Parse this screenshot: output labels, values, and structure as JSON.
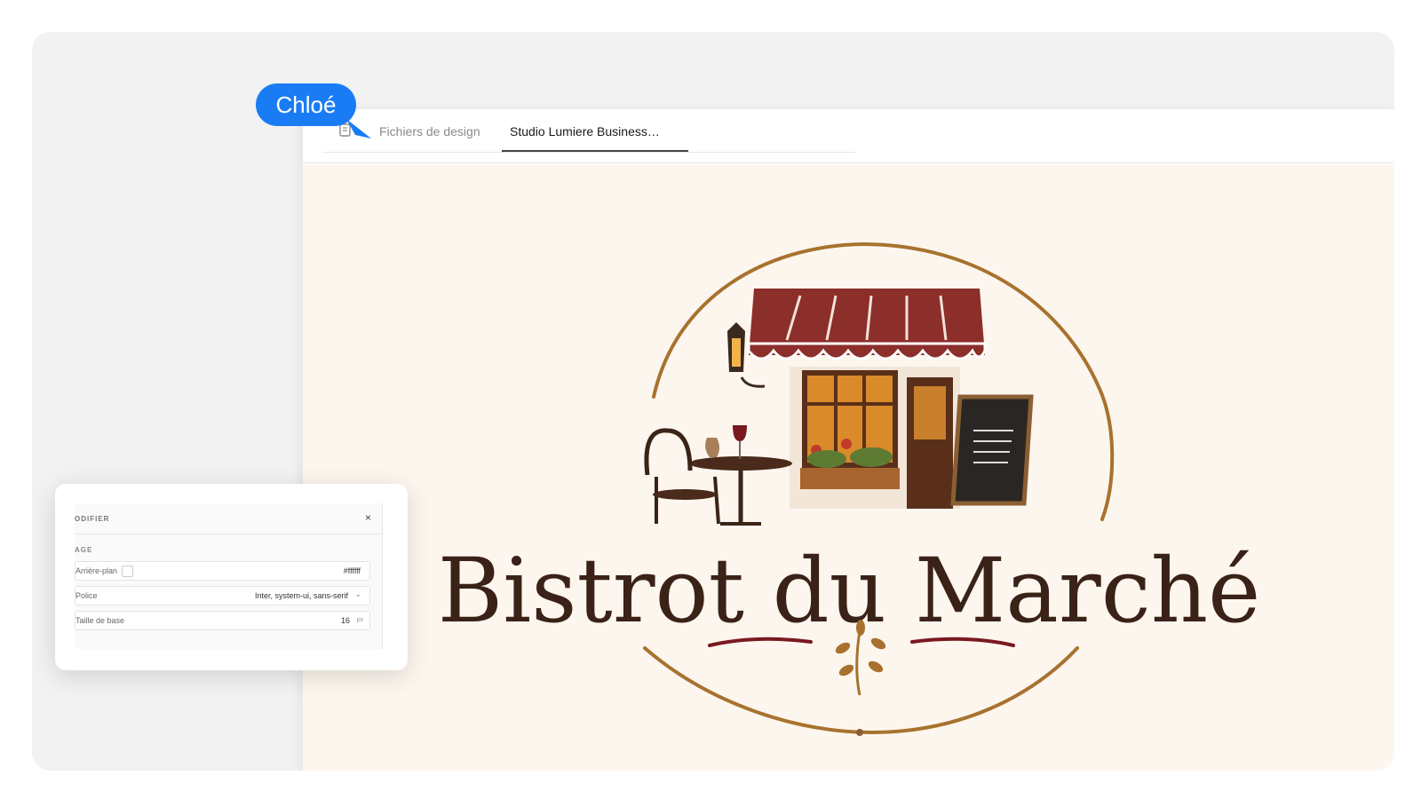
{
  "tabs": {
    "files_label": "Fichiers de design",
    "active_label": "Studio Lumiere Business…"
  },
  "collaborator": {
    "name": "Chloé",
    "color": "#1a7cf5"
  },
  "logo": {
    "title": "Bistrot du Marché"
  },
  "panel": {
    "title": "ODIFIER",
    "close_symbol": "×",
    "section": "AGE",
    "background_label": "Arrière-plan",
    "background_value": "#ffffff",
    "font_label": "Police",
    "font_value": "Inter, system-ui, sans-serif",
    "size_label": "Taille de base",
    "size_value": "16",
    "size_unit": "px"
  },
  "icons": [
    "files-icon",
    "close-icon",
    "chevron-down-icon",
    "cursor-pointer-icon"
  ]
}
